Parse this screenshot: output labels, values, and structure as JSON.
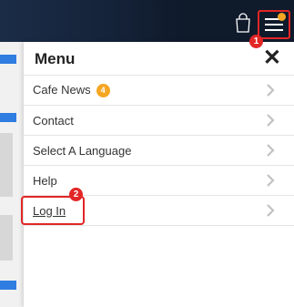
{
  "header": {
    "cart_icon": "shopping-bag-icon",
    "menu_icon": "hamburger-menu-icon",
    "notification_dot_color": "#f5a623"
  },
  "menu": {
    "title": "Menu",
    "close_glyph": "✕",
    "items": [
      {
        "label": "Cafe News",
        "badge": "4"
      },
      {
        "label": "Contact"
      },
      {
        "label": "Select A Language"
      },
      {
        "label": "Help"
      },
      {
        "label": "Log In"
      }
    ]
  },
  "annotations": {
    "step1": "1",
    "step2": "2",
    "highlight_color": "#e22626"
  }
}
